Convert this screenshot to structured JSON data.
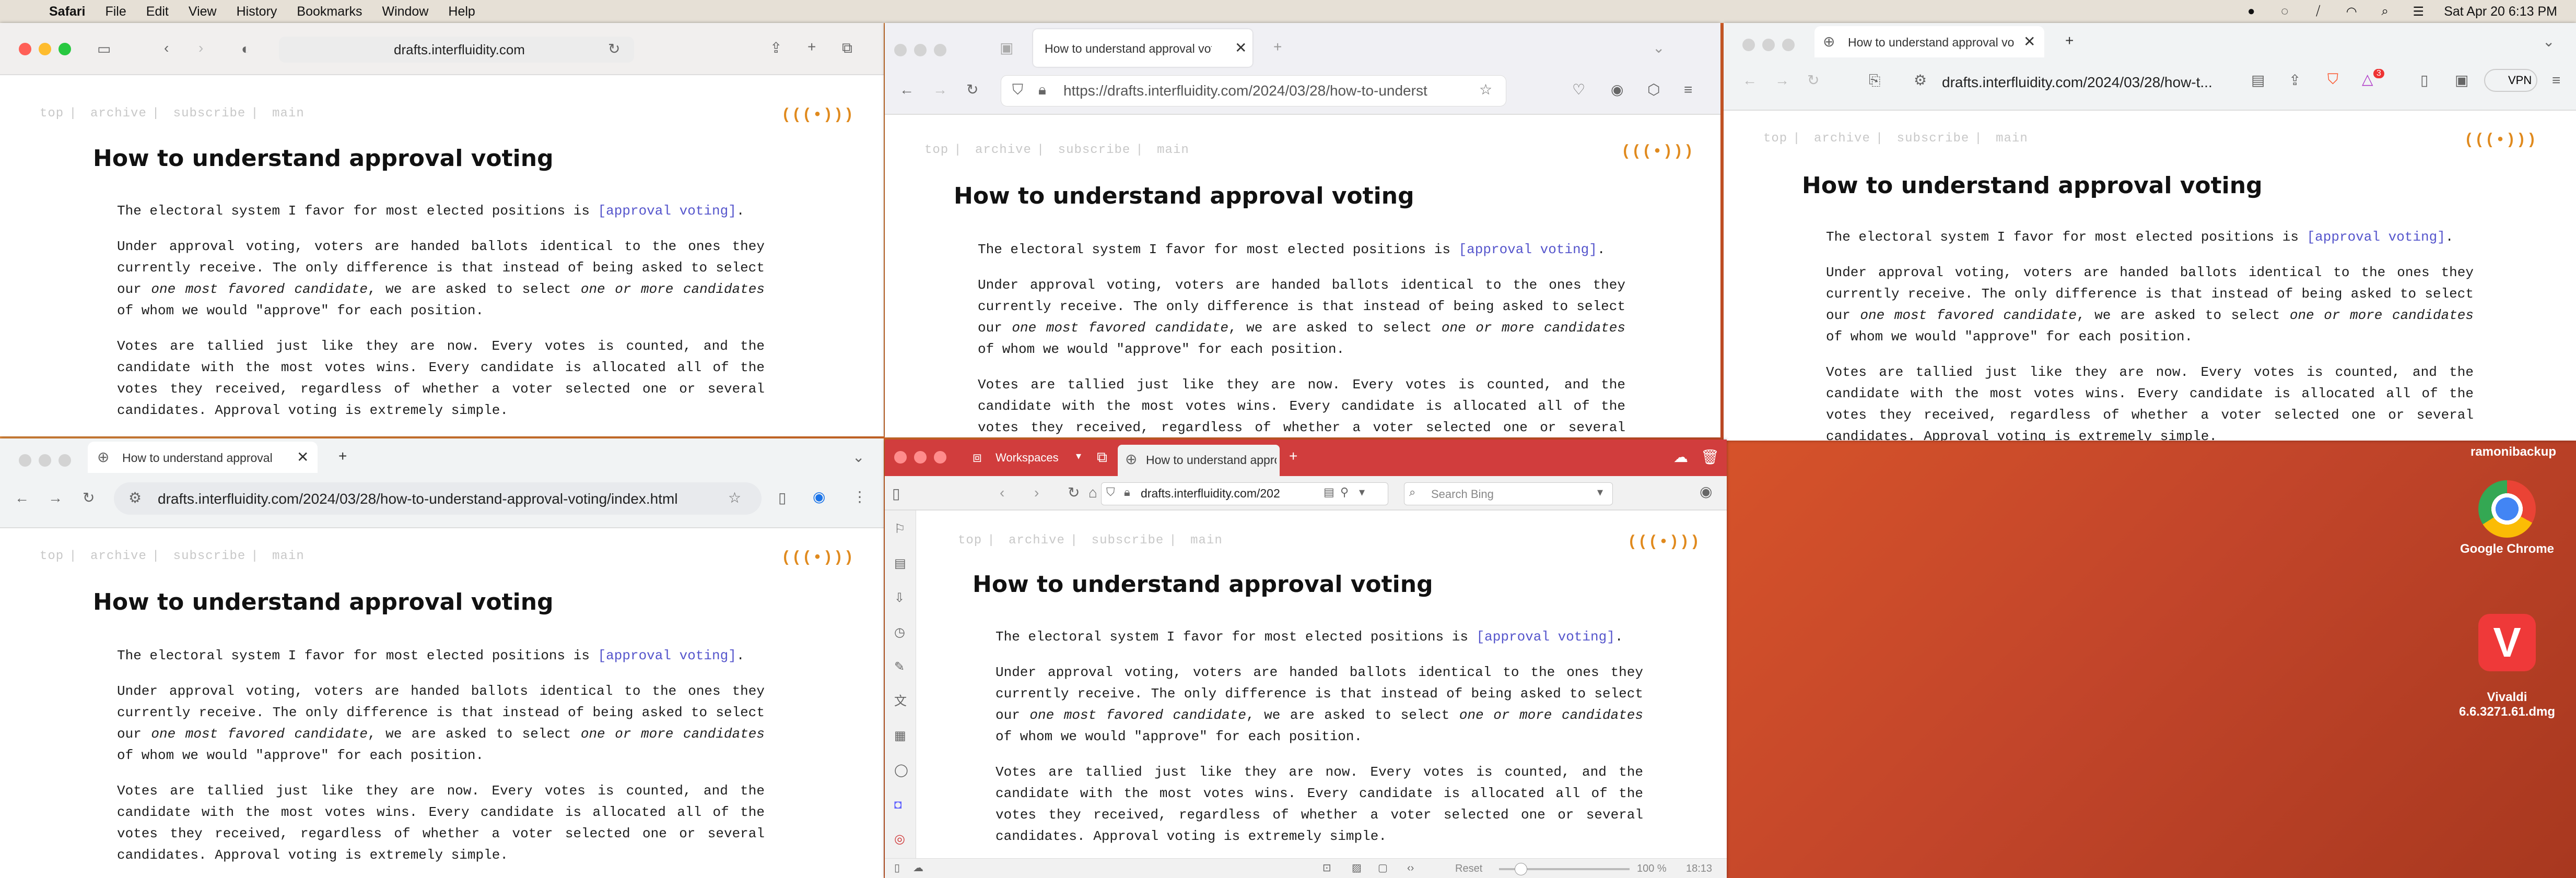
{
  "menubar": {
    "app": "Safari",
    "items": [
      "File",
      "Edit",
      "View",
      "History",
      "Bookmarks",
      "Window",
      "Help"
    ],
    "datetime": "Sat Apr 20  6:13 PM"
  },
  "article": {
    "nav": [
      "top",
      "archive",
      "subscribe",
      "main"
    ],
    "logo": "(((•)))",
    "title": "How to understand approval voting",
    "p1_pre": "The electoral system I favor for most elected positions is ",
    "p1_link": "[approval voting]",
    "p1_post": ".",
    "p2_a": "Under approval voting, voters are handed ballots identical to the ones they currently receive. The only difference is that instead of being asked to select our ",
    "p2_i1": "one most favored candidate",
    "p2_b": ", we are asked to select ",
    "p2_i2": "one or more candidates",
    "p2_c": " of whom we would \"approve\" for each position.",
    "p3": "Votes are tallied just like they are now. Every votes is counted, and the candidate with the most votes wins. Every candidate is allocated all of the votes they received, regardless of whether a voter selected one or several candidates. Approval voting is extremely simple."
  },
  "safari": {
    "url": "drafts.interfluidity.com"
  },
  "firefox": {
    "tab": "How to understand approval voting",
    "url": "https://drafts.interfluidity.com/2024/03/28/how-to-underst"
  },
  "brave": {
    "tab": "How to understand approval vo",
    "url": "drafts.interfluidity.com/2024/03/28/how-t...",
    "vpn": "VPN",
    "badge": "3"
  },
  "chrome": {
    "tab": "How to understand approval",
    "url": "drafts.interfluidity.com/2024/03/28/how-to-understand-approval-voting/index.html"
  },
  "vivaldi": {
    "workspaces": "Workspaces",
    "tab": "How to understand approv",
    "url": "drafts.interfluidity.com/202",
    "search": "Search Bing",
    "reset": "Reset",
    "zoom": "100 %",
    "time": "18:13"
  },
  "desktop": {
    "volume": "ramonibackup",
    "chrome": "Google Chrome",
    "vivaldi": "Vivaldi\n6.6.3271.61.dmg"
  }
}
